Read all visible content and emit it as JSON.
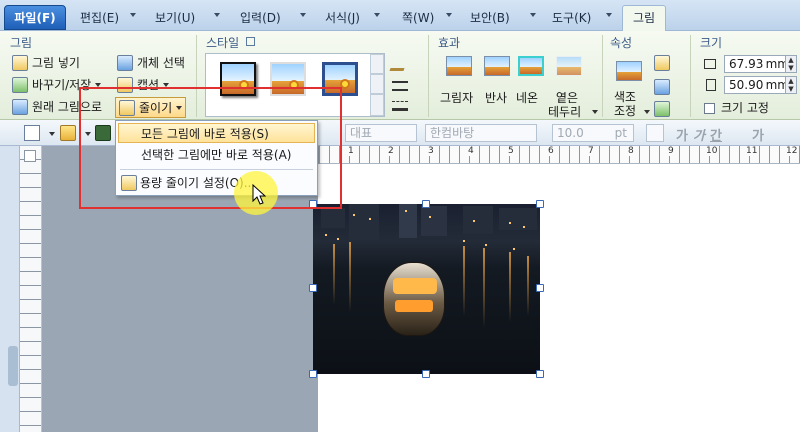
{
  "menubar": {
    "file": "파일(F)",
    "tabs": [
      "편집(E)",
      "보기(U)",
      "입력(D)",
      "서식(J)",
      "쪽(W)",
      "보안(B)",
      "도구(K)"
    ],
    "active_tab": "그림"
  },
  "ribbon": {
    "picture_group": {
      "title": "그림",
      "insert": "그림 넣기",
      "select_object": "개체 선택",
      "replace_save": "바꾸기/저장",
      "caption": "캡션",
      "original": "원래 그림으로",
      "compress": "줄이기"
    },
    "style_group": {
      "title": "스타일"
    },
    "effect_group": {
      "title": "효과",
      "shadow": "그림자",
      "reflection": "반사",
      "neon": "네온",
      "soft_edge_1": "옅은",
      "soft_edge_2": "테두리"
    },
    "property_group": {
      "title": "속성",
      "color_1": "색조",
      "color_2": "조정"
    },
    "size_group": {
      "title": "크기",
      "width": "67.93",
      "height": "50.90",
      "unit": "mm",
      "fix_size": "크기 고정"
    }
  },
  "toolbar": {
    "style_combo": "대표",
    "font_combo": "한컴바탕",
    "size_combo": "10.0",
    "size_unit": "pt",
    "bold_samples": [
      "가",
      "가",
      "간",
      "가"
    ]
  },
  "dropdown": {
    "items": [
      "모든 그림에 바로 적용(S)",
      "선택한 그림에만 바로 적용(A)",
      "용량 줄이기 설정(O)..."
    ]
  },
  "ruler": {
    "labels": [
      "1",
      "2",
      "3",
      "4",
      "5",
      "6",
      "7",
      "8",
      "9",
      "10",
      "11",
      "12"
    ]
  },
  "colors": {
    "annotation": "#e03030",
    "highlight": "#fff53c",
    "ribbon_bg": "#f6faf2",
    "file_tab": "#2b6fc6"
  }
}
